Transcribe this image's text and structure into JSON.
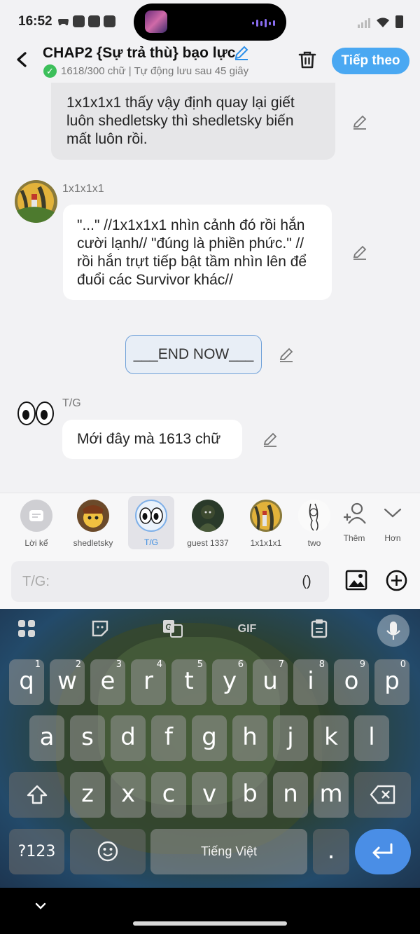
{
  "status_bar": {
    "time": "16:52"
  },
  "header": {
    "title": "CHAP2 {Sự trả thù} bạo lực",
    "status": "1618/300 chữ | Tự động lưu sau 45 giây",
    "next_label": "Tiếp theo"
  },
  "messages": [
    {
      "type": "narration",
      "text": "1x1x1x1 thấy vậy định quay lại giết luôn shedletsky thì shedletsky biến mất luôn rồi."
    },
    {
      "type": "dialogue",
      "speaker": "1x1x1x1",
      "text": "\"...\" //1x1x1x1 nhìn cảnh đó rồi hắn cười lạnh// \"đúng là phiền phức.\" // rồi hắn trựt tiếp bật tầm nhìn lên để đuổi các Survivor khác//"
    },
    {
      "type": "marker",
      "text": "___END NOW___"
    },
    {
      "type": "dialogue",
      "speaker": "T/G",
      "text": "Mới đây mà 1613 chữ"
    }
  ],
  "characters": [
    {
      "name": "Lời kể",
      "icon": "narration-icon"
    },
    {
      "name": "shedletsky"
    },
    {
      "name": "T/G",
      "selected": true
    },
    {
      "name": "guest 1337"
    },
    {
      "name": "1x1x1x1"
    },
    {
      "name": "two"
    },
    {
      "name": "Thêm",
      "icon": "add-person-icon"
    },
    {
      "name": "Hơn",
      "icon": "chevron-down-icon"
    }
  ],
  "input": {
    "placeholder": "T/G:",
    "paren_label": "()"
  },
  "keyboard": {
    "row1": [
      "q",
      "w",
      "e",
      "r",
      "t",
      "y",
      "u",
      "i",
      "o",
      "p"
    ],
    "row1_hints": [
      "1",
      "2",
      "3",
      "4",
      "5",
      "6",
      "7",
      "8",
      "9",
      "0"
    ],
    "row2": [
      "a",
      "s",
      "d",
      "f",
      "g",
      "h",
      "j",
      "k",
      "l"
    ],
    "row3": [
      "z",
      "x",
      "c",
      "v",
      "b",
      "n",
      "m"
    ],
    "num_label": "?123",
    "space_label": "Tiếng Việt",
    "period": ".",
    "toolbar": [
      "apps-grid-icon",
      "sticker-icon",
      "translate-icon",
      "gif-icon",
      "clipboard-icon",
      "mic-icon"
    ],
    "gif_label": "GIF",
    "translate_label": "G"
  },
  "colors": {
    "accent": "#4aa8f2",
    "bubble": "#ffffff",
    "narration": "#e6e6e8",
    "check": "#3cbf5a"
  }
}
